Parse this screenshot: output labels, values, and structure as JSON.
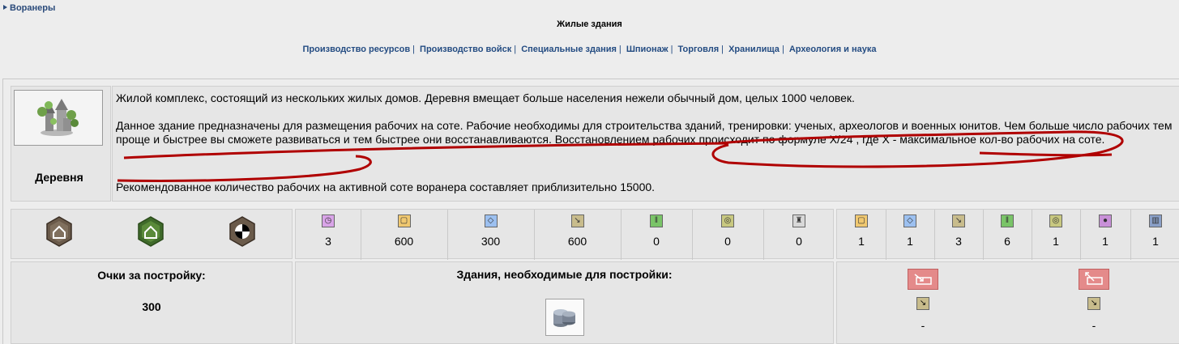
{
  "breadcrumb": {
    "label": "Воранеры"
  },
  "page_title": "Жилые здания",
  "nav": [
    {
      "label": "Производство ресурсов"
    },
    {
      "label": "Производство войск"
    },
    {
      "label": "Специальные здания"
    },
    {
      "label": "Шпионаж"
    },
    {
      "label": "Торговля"
    },
    {
      "label": "Хранилища"
    },
    {
      "label": "Археология и наука"
    }
  ],
  "nav_separator": "|",
  "building": {
    "name": "Деревня",
    "icon": "village-building-icon",
    "description": [
      "Жилой комплекс, состоящий из нескольких жилых домов. Деревня вмещает больше населения нежели обычный дом, целых 1000 человек.",
      "Данное здание предназначены для размещения рабочих на соте. Рабочие необходимы для строительства зданий, тренировки: ученых, археологов и военных юнитов. Чем больше число рабочих тем проще и быстрее вы сможете развиваться и тем быстрее они восстанавливаются. Восстановлением рабочих происходит по формуле X/24 , где X - максимальное кол-во рабочих на соте.",
      "Рекомендованное количество рабочих на активной соте воранера составляет приблизительно 15000."
    ]
  },
  "terrain_icons": [
    "house-hex-icon",
    "green-house-hex-icon",
    "checkered-hex-icon"
  ],
  "costs": [
    {
      "icon": "time-icon",
      "color": "#d9a4e8",
      "value": "3"
    },
    {
      "icon": "gold-icon",
      "color": "#f0c870",
      "value": "600"
    },
    {
      "icon": "crystal-icon",
      "color": "#9cc0f0",
      "value": "300"
    },
    {
      "icon": "tools-icon",
      "color": "#c8bc8c",
      "value": "600"
    },
    {
      "icon": "workers-icon",
      "color": "#7ac468",
      "value": "0"
    },
    {
      "icon": "food-icon",
      "color": "#c8c880",
      "value": "0"
    },
    {
      "icon": "soldier-icon",
      "color": "#d8d8d8",
      "value": "0"
    }
  ],
  "production": [
    {
      "icon": "gold-icon",
      "color": "#f0c870",
      "value": "1"
    },
    {
      "icon": "crystal-icon",
      "color": "#9cc0f0",
      "value": "1"
    },
    {
      "icon": "tools-icon",
      "color": "#c8bc8c",
      "value": "3"
    },
    {
      "icon": "workers-icon",
      "color": "#7ac468",
      "value": "6"
    },
    {
      "icon": "food-icon",
      "color": "#c8c880",
      "value": "1"
    },
    {
      "icon": "pearl-icon",
      "color": "#c890d8",
      "value": "1"
    },
    {
      "icon": "book-icon",
      "color": "#8aa0c8",
      "value": "1"
    }
  ],
  "points": {
    "label": "Очки за постройку:",
    "value": "300"
  },
  "required": {
    "label": "Здания, необходимые для постройки:",
    "icon": "coins-building-icon"
  },
  "actions": [
    {
      "icon": "downgrade-icon",
      "resource_icon": "tools-icon",
      "value": "-"
    },
    {
      "icon": "upgrade-icon",
      "resource_icon": "tools-icon",
      "value": "-"
    }
  ],
  "colors": {
    "link": "#244c82",
    "annotation": "#b00000",
    "action_red": "#e48a8a"
  }
}
